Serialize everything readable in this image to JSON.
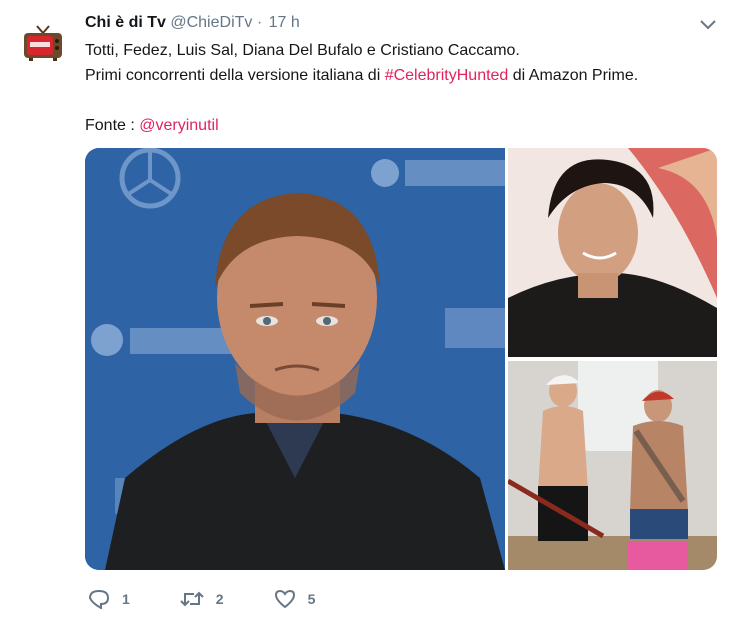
{
  "tweet": {
    "author_name": "Chi è di Tv",
    "handle": "@ChieDiTv",
    "separator": "·",
    "time": "17 h",
    "line1": "Totti, Fedez, Luis Sal, Diana Del Bufalo e Cristiano Caccamo.",
    "line2_prefix": "Primi concorrenti della versione italiana di ",
    "hashtag": "#CelebrityHunted",
    "line2_suffix": " di Amazon Prime.",
    "source_label": "Fonte : ",
    "source_mention": "@veryinutil"
  },
  "actions": {
    "reply_count": "1",
    "retweet_count": "2",
    "like_count": "5"
  },
  "colors": {
    "accent": "#e0245e",
    "muted": "#657786",
    "text": "#14171a"
  },
  "icons": [
    "tv-logo-icon",
    "chevron-down-icon",
    "reply-icon",
    "retweet-icon",
    "like-icon"
  ]
}
